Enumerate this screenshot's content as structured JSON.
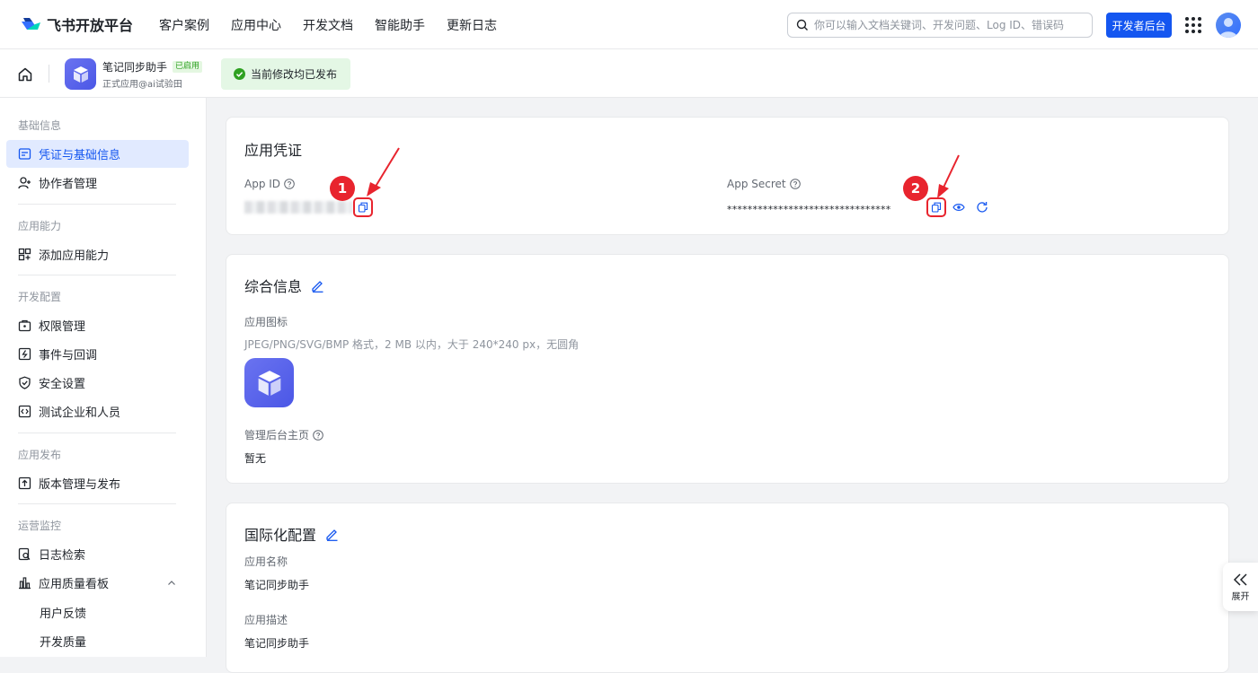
{
  "brand": {
    "name": "飞书开放平台"
  },
  "nav": {
    "items": [
      "客户案例",
      "应用中心",
      "开发文档",
      "智能助手",
      "更新日志"
    ]
  },
  "search": {
    "placeholder": "你可以输入文档关键词、开发问题、Log ID、错误码"
  },
  "header": {
    "dev_console_label": "开发者后台"
  },
  "app": {
    "name": "笔记同步助手",
    "status_tag": "已启用",
    "subtitle": "正式应用@ai试验田",
    "publish_status": "当前修改均已发布"
  },
  "sidebar": {
    "groups": [
      {
        "title": "基础信息",
        "items": [
          "凭证与基础信息",
          "协作者管理"
        ]
      },
      {
        "title": "应用能力",
        "items": [
          "添加应用能力"
        ]
      },
      {
        "title": "开发配置",
        "items": [
          "权限管理",
          "事件与回调",
          "安全设置",
          "测试企业和人员"
        ]
      },
      {
        "title": "应用发布",
        "items": [
          "版本管理与发布"
        ]
      },
      {
        "title": "运营监控",
        "items": [
          "日志检索",
          "应用质量看板",
          "用户反馈",
          "开发质量"
        ]
      }
    ],
    "active_item": "凭证与基础信息"
  },
  "credentials": {
    "title": "应用凭证",
    "app_id_label": "App ID",
    "app_secret_label": "App Secret",
    "app_secret_value": "********************************",
    "annotation_1": "1",
    "annotation_2": "2",
    "accent_color": "#e8242e"
  },
  "general": {
    "title": "综合信息",
    "icon_label": "应用图标",
    "icon_hint": "JPEG/PNG/SVG/BMP 格式，2 MB 以内，大于 240*240 px，无圆角",
    "admin_home_label": "管理后台主页",
    "admin_home_value": "暂无"
  },
  "i18n": {
    "title": "国际化配置",
    "name_label": "应用名称",
    "name_value": "笔记同步助手",
    "desc_label": "应用描述",
    "desc_value": "笔记同步助手"
  },
  "expand_panel": {
    "label": "展开"
  },
  "colors": {
    "primary": "#1456f0",
    "active_bg": "#e1eaff",
    "success_bg": "#e4f7e5"
  }
}
